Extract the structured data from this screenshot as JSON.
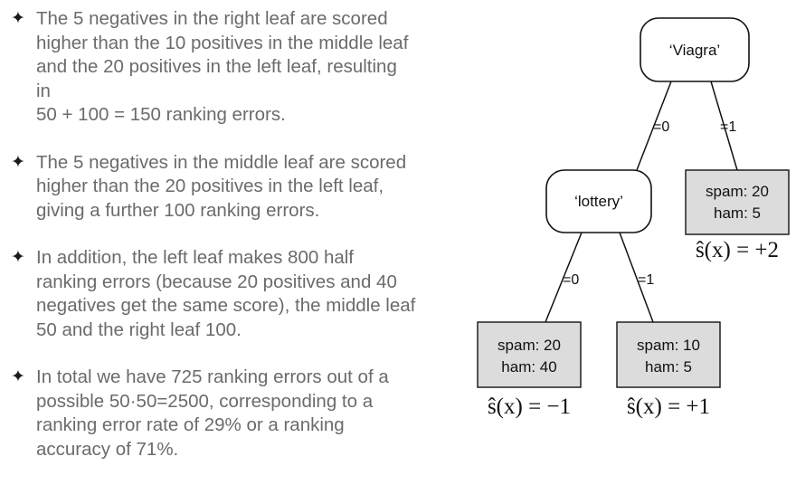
{
  "bullets": [
    {
      "lines": [
        "The 5 negatives in the right leaf are scored",
        "higher than the 10 positives in the middle leaf",
        "and the 20 positives in the left leaf, resulting",
        "in",
        "50 + 100 = 150 ranking errors."
      ]
    },
    {
      "lines": [
        "The 5 negatives in the middle leaf are scored",
        "higher than the 20 positives in the left leaf,",
        "giving a further 100 ranking errors."
      ]
    },
    {
      "lines": [
        "In addition, the left leaf makes 800 half",
        "ranking errors (because 20 positives and 40",
        "negatives get the same score), the middle leaf",
        "50 and the right leaf 100."
      ]
    },
    {
      "lines": [
        "In total we have 725 ranking errors out of a",
        "possible 50·50=2500, corresponding to a",
        "ranking error rate of 29% or a ranking",
        "accuracy of 71%."
      ]
    }
  ],
  "bullet_symbol": "✦",
  "tree": {
    "root": {
      "label": "‘Viagra’"
    },
    "inner": {
      "label": "‘lottery’"
    },
    "edges": {
      "root_left": "=0",
      "root_right": "=1",
      "inner_left": "=0",
      "inner_right": "=1"
    },
    "leaves": {
      "right": {
        "spam": "spam: 20",
        "ham": "ham: 5",
        "score": "ŝ(x) = +2"
      },
      "left": {
        "spam": "spam: 20",
        "ham": "ham: 40",
        "score": "ŝ(x) = −1"
      },
      "middle": {
        "spam": "spam: 10",
        "ham": "ham: 5",
        "score": "ŝ(x) = +1"
      }
    }
  },
  "colors": {
    "leaf_fill": "#dcdcdc",
    "text_gray": "#6b6b6b"
  }
}
